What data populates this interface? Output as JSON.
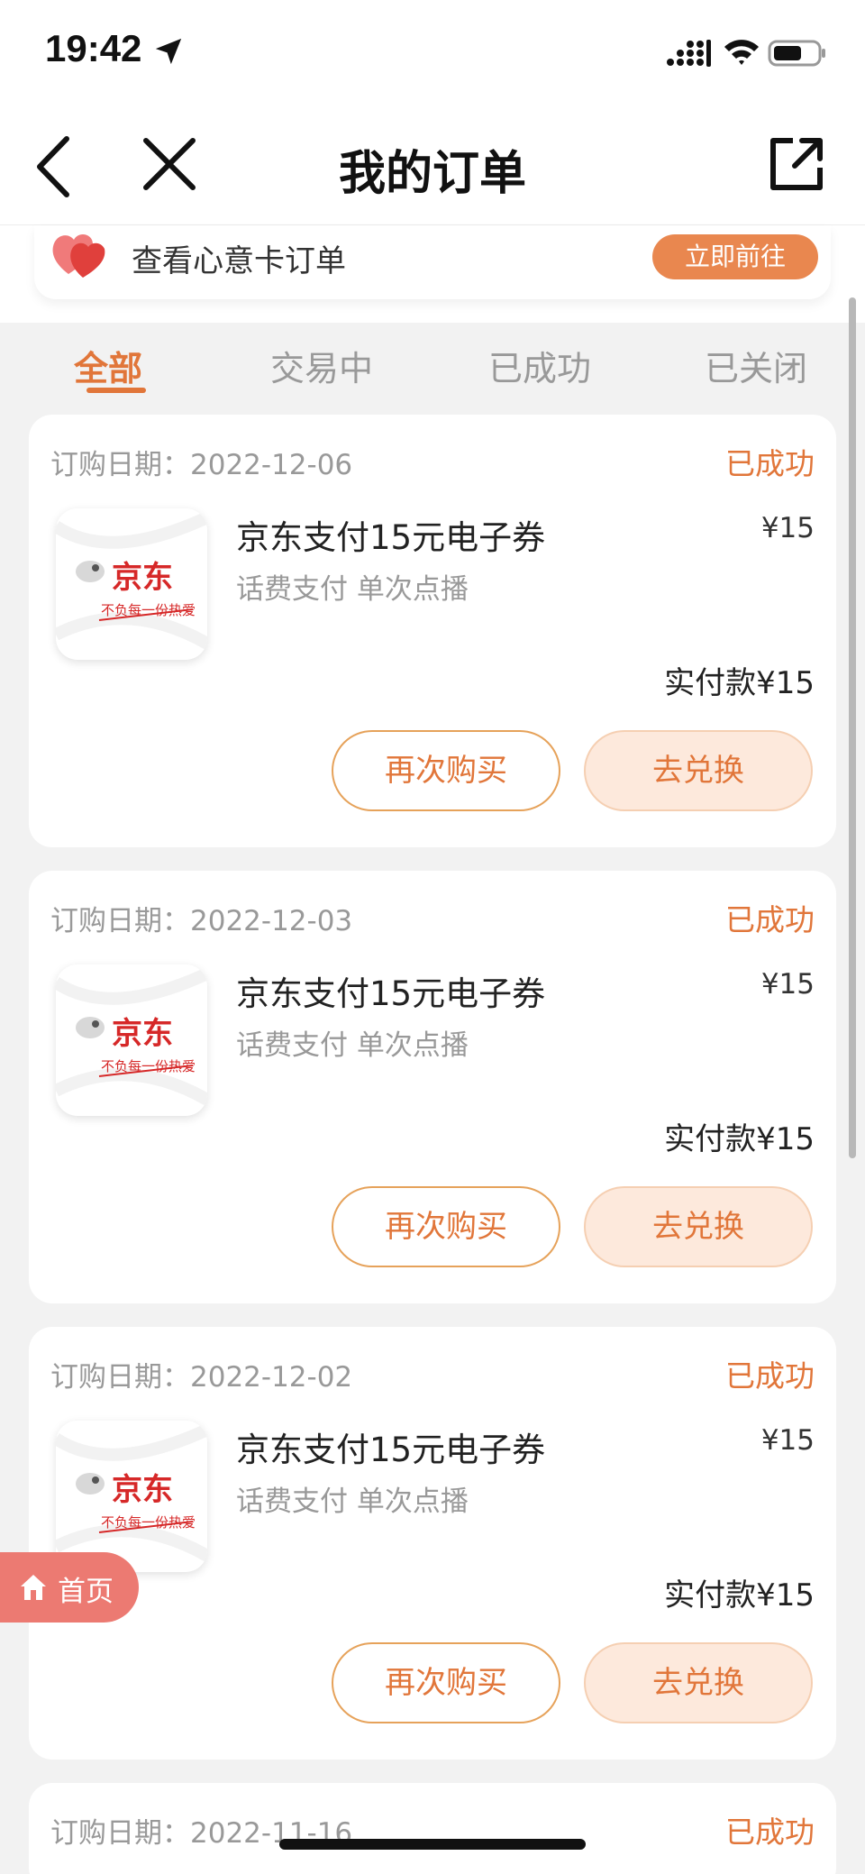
{
  "status_bar": {
    "time": "19:42"
  },
  "nav": {
    "title": "我的订单"
  },
  "banner": {
    "text": "查看心意卡订单",
    "button": "立即前往"
  },
  "tabs": [
    {
      "label": "全部",
      "active": true
    },
    {
      "label": "交易中",
      "active": false
    },
    {
      "label": "已成功",
      "active": false
    },
    {
      "label": "已关闭",
      "active": false
    }
  ],
  "orders": [
    {
      "date": "订购日期：2022-12-06",
      "status": "已成功",
      "name": "京东支付15元电子券",
      "price": "¥15",
      "desc": "话费支付 单次点播",
      "paid": "实付款¥15",
      "rebuy": "再次购买",
      "redeem": "去兑换"
    },
    {
      "date": "订购日期：2022-12-03",
      "status": "已成功",
      "name": "京东支付15元电子券",
      "price": "¥15",
      "desc": "话费支付 单次点播",
      "paid": "实付款¥15",
      "rebuy": "再次购买",
      "redeem": "去兑换"
    },
    {
      "date": "订购日期：2022-12-02",
      "status": "已成功",
      "name": "京东支付15元电子券",
      "price": "¥15",
      "desc": "话费支付 单次点播",
      "paid": "实付款¥15",
      "rebuy": "再次购买",
      "redeem": "去兑换"
    },
    {
      "date": "订购日期：2022-11-16",
      "status": "已成功"
    }
  ],
  "thumb": {
    "brand": "京东",
    "slogan": "不负每一份热爱"
  },
  "home_float": {
    "label": "首页"
  },
  "colors": {
    "accent": "#e1763a",
    "banner_button": "#e9874f",
    "home_float": "#ec7a72"
  }
}
